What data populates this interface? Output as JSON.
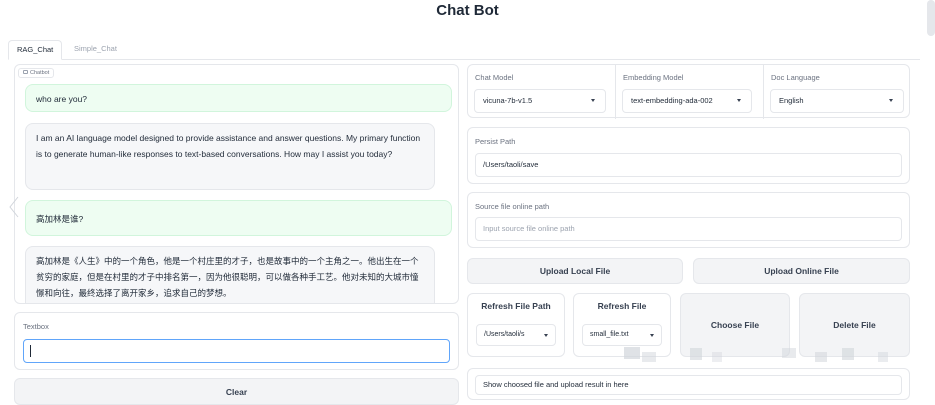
{
  "app": {
    "title": "Chat Bot"
  },
  "tabs": [
    {
      "label": "RAG_Chat",
      "active": true
    },
    {
      "label": "Simple_Chat",
      "active": false
    }
  ],
  "chatbot": {
    "label": "Chatbot",
    "messages": [
      {
        "role": "user",
        "text": "who are you?"
      },
      {
        "role": "bot",
        "text": "I am an AI language model designed to provide assistance and answer questions. My primary function is to generate human-like responses to text-based conversations. How may I assist you today?"
      },
      {
        "role": "user",
        "text": "高加林是谁?"
      },
      {
        "role": "bot",
        "text": "高加林是《人生》中的一个角色，他是一个村庄里的才子，也是故事中的一个主角之一。他出生在一个贫穷的家庭，但是在村里的才子中排名第一，因为他很聪明，可以做各种手工艺。他对未知的大城市憧憬和向往，最终选择了离开家乡，追求自己的梦想。"
      }
    ]
  },
  "textbox": {
    "label": "Textbox",
    "value": ""
  },
  "clear_button": "Clear",
  "settings": {
    "chat_model": {
      "label": "Chat Model",
      "value": "vicuna-7b-v1.5"
    },
    "embedding_model": {
      "label": "Embedding Model",
      "value": "text-embedding-ada-002"
    },
    "doc_language": {
      "label": "Doc Language",
      "value": "English"
    }
  },
  "persist_path": {
    "label": "Persist Path",
    "value": "/Users/taoli/save"
  },
  "source_path": {
    "label": "Source file online path",
    "placeholder": "Input source file online path"
  },
  "buttons": {
    "upload_local": "Upload Local File",
    "upload_online": "Upload Online File",
    "refresh_path": "Refresh File Path",
    "refresh_file": "Refresh File",
    "choose_file": "Choose File",
    "delete_file": "Delete File"
  },
  "file_selects": {
    "path_value": "/Users/taoli/s",
    "file_value": "small_file.txt"
  },
  "result": {
    "text": "Show choosed file and upload result in here"
  },
  "colors": {
    "user_bubble": "#eefdf2",
    "bot_bubble": "#f6f7f9",
    "focus_border": "#60a5fa",
    "button_bg": "#f3f4f6"
  }
}
